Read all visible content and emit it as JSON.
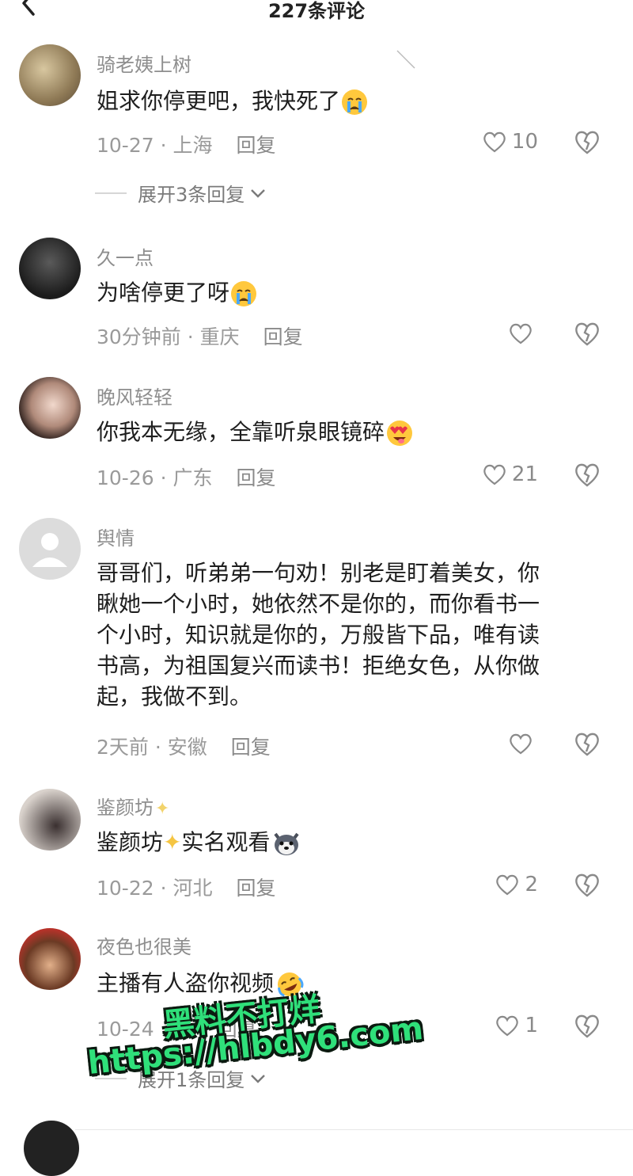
{
  "header": {
    "title": "227条评论"
  },
  "comments": [
    {
      "name": "骑老姨上树",
      "text": "姐求你停更吧，我快死了",
      "date": "10-27",
      "location": "上海",
      "reply": "回复",
      "likes": "10",
      "expand": "展开3条回复"
    },
    {
      "name": "久一点",
      "text": "为啥停更了呀",
      "date": "30分钟前",
      "location": "重庆",
      "reply": "回复",
      "likes": ""
    },
    {
      "name": "晚风轻轻",
      "text": "你我本无缘，全靠听泉眼镜碎",
      "date": "10-26",
      "location": "广东",
      "reply": "回复",
      "likes": "21"
    },
    {
      "name": "舆情",
      "lines": [
        "哥哥们，听弟弟一句劝！别老是盯着美女，你",
        "瞅她一个小时，她依然不是你的，而你看书一",
        "个小时，知识就是你的，万般皆下品，唯有读",
        "书高，为祖国复兴而读书！拒绝女色，从你做",
        "起，我做不到。"
      ],
      "date": "2天前",
      "location": "安徽",
      "reply": "回复",
      "likes": ""
    },
    {
      "name": "鉴颜坊",
      "text_a": "鉴颜坊",
      "text_b": "实名观看",
      "date": "10-22",
      "location": "河北",
      "reply": "回复",
      "likes": "2"
    },
    {
      "name": "夜色也很美",
      "text": "主播有人盗你视频",
      "date": "10-24",
      "location": "",
      "reply": "回复",
      "likes": "1",
      "expand": "展开1条回复"
    }
  ],
  "watermark": {
    "line1": "黑料不打烊",
    "line2": "https://hlbdy6.com"
  },
  "colors": {
    "accent_watermark": "#2fe07a",
    "meta_gray": "#9a9a9a"
  }
}
